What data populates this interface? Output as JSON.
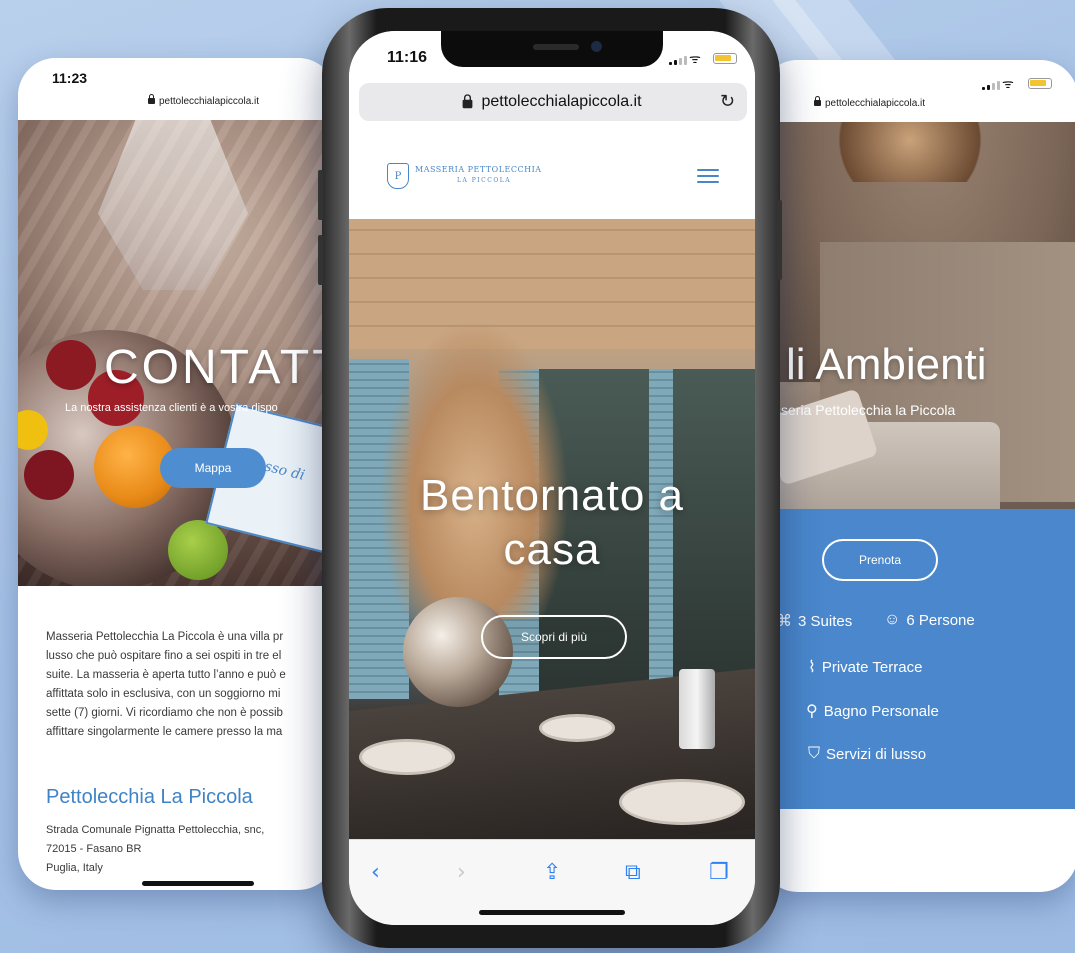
{
  "colors": {
    "accent": "#4a87cc",
    "button_blue": "#4e8ed0",
    "ios_blue": "#2f7ff5"
  },
  "left_phone": {
    "status_time": "11:23",
    "url": "pettolecchialapiccola.it",
    "hero_title": "CONTATT",
    "hero_subtitle": "La nostra assistenza clienti è a vostra dispo",
    "map_button": "Mappa",
    "card_text": "Il lusso di",
    "description": "Masseria Pettolecchia La Piccola è una villa pr\nlusso che può ospitare fino a sei ospiti in tre el\nsuite. La masseria è aperta tutto l’anno e può e\naffittata solo in esclusiva, con un soggiorno mi\nsette (7) giorni. Vi ricordiamo che non è possib\naffittare singolarmente le camere presso la ma",
    "property_title": "Pettolecchia La Piccola",
    "address": "Strada Comunale Pignatta Pettolecchia, snc,\n72015 - Fasano BR\nPuglia, Italy"
  },
  "center_phone": {
    "status_time": "11:16",
    "url": "pettolecchialapiccola.it",
    "logo_name": "MASSERIA PETTOLECCHIA",
    "logo_sub": "LA PICCOLA",
    "logo_initials": "P",
    "hero_title_line1": "Bentornato a",
    "hero_title_line2": "casa",
    "cta_button": "Scopri di più",
    "toolbar": {
      "back_icon": "chevron-left-icon",
      "forward_icon": "chevron-right-icon",
      "share_icon": "share-icon",
      "bookmarks_icon": "book-icon",
      "tabs_icon": "tabs-icon"
    }
  },
  "right_phone": {
    "url": "pettolecchialapiccola.it",
    "hero_title": "li Ambienti",
    "hero_subtitle": "sseria Pettolecchia la Piccola",
    "book_button": "Prenota",
    "features": {
      "suites": "3 Suites",
      "guests": "6 Persone",
      "terrace": "Private Terrace",
      "bathroom": "Bagno Personale",
      "luxury": "Servizi di lusso"
    }
  }
}
